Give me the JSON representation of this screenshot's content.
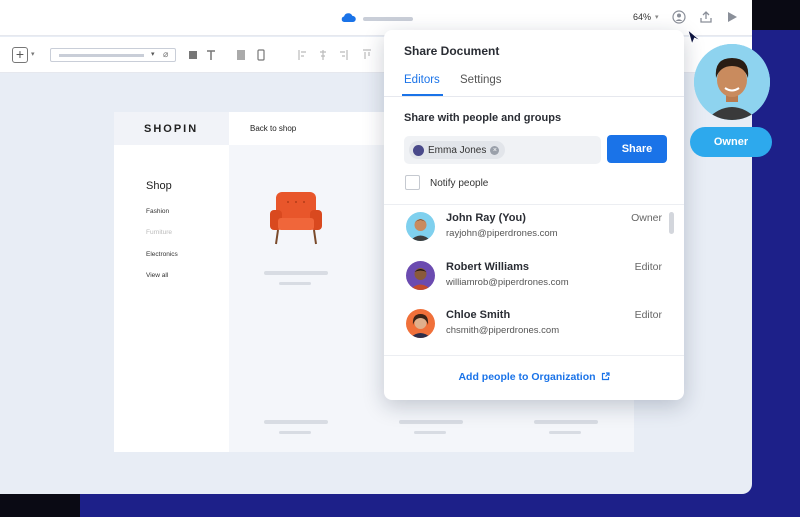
{
  "topbar": {
    "zoom": "64%",
    "icons": [
      "cloud-icon",
      "user-icon",
      "upload-icon",
      "play-icon"
    ]
  },
  "canvas": {
    "brand": "SHOPIN",
    "back_link": "Back to shop",
    "sidebar_title": "Shop",
    "categories": [
      "Fashion",
      "Furniture",
      "Electronics",
      "View all"
    ]
  },
  "share_panel": {
    "title": "Share Document",
    "tabs": [
      "Editors",
      "Settings"
    ],
    "active_tab": "Editors",
    "section_label": "Share with people and groups",
    "invitee_chip": "Emma Jones",
    "share_button": "Share",
    "notify_label": "Notify people",
    "people": [
      {
        "name": "John Ray (You)",
        "email": "rayjohn@piperdrones.com",
        "role": "Owner"
      },
      {
        "name": "Robert Williams",
        "email": "williamrob@piperdrones.com",
        "role": "Editor"
      },
      {
        "name": "Chloe Smith",
        "email": "chsmith@piperdrones.com",
        "role": "Editor"
      }
    ],
    "add_org_link": "Add people to Organization"
  },
  "owner_badge": "Owner",
  "colors": {
    "accent": "#1a73e8",
    "owner_badge": "#2da9ed",
    "background": "#1d2089"
  }
}
